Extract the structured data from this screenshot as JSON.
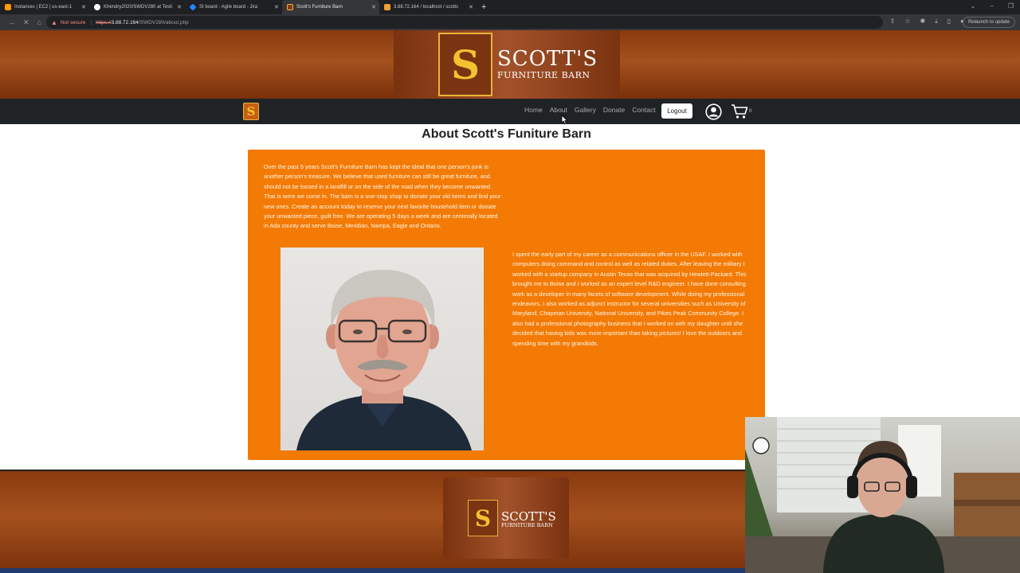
{
  "browser": {
    "tabs": [
      {
        "title": "Instances | EC2 | us-east-1",
        "color": "#ff9900",
        "active": false
      },
      {
        "title": "Khendry2020/SWDV280 at Testi",
        "color": "#ffffff",
        "active": false
      },
      {
        "title": "SI board - Agile board - Jira",
        "color": "#2684ff",
        "active": false
      },
      {
        "title": "Scott's Furniture Barn",
        "color": "#e6b53a",
        "active": true
      },
      {
        "title": "3.88.72.164 / localhost / scotts",
        "color": "#f0a030",
        "active": false
      }
    ],
    "address": {
      "security_label": "Not secure",
      "scheme": "https://",
      "host": "3.88.72.164",
      "path": "/SWDV280/about.php"
    },
    "relaunch_label": "Relaunch to update"
  },
  "site": {
    "logo": {
      "letter": "S",
      "name": "SCOTT'S",
      "subtitle": "FURNITURE BARN"
    },
    "nav": {
      "brand_letter": "S",
      "links": [
        "Home",
        "About",
        "Gallery",
        "Donate",
        "Contact"
      ],
      "logout_label": "Logout",
      "cart_count": "0"
    },
    "page_title": "About Scott's Funiture Barn",
    "intro_text": "Over the past 5 years Scott's Furniture Barn has kept the ideal that one person's junk is another person's treasure. We believe that used furniture can still be great furniture, and should not be tossed in a landfill or on the side of the road when they become unwanted. That is were we come in. The barn is a one-stop shop to donate your old items and find your new ones. Create an account today to reserve your next favorite household item or donate your unwanted piece, guilt free. We are operating 5 days a week and are centerally located in Ada county and serve Boise, Meridian, Nampa, Eagle and Ontario.",
    "bio_text": "I spent the early part of my career as a communications officer in the USAF. I worked with computers doing command and control as well as related duties. After leaving the military I worked with a startup company in Austin Texas that was acquired by Hewlett-Packard. This brought me to Boise and I worked as an expert level R&D engineer. I have done consulting work as a developer in many facets of software development. While doing my professional endeavors, I also worked as adjunct instructor for several universities such as University of Maryland, Chapman University, National University, and Pikes Peak Community College. I also had a professional photography business that I worked on with my daughter until she decided that having kids was more important than taking pictures! I love the outdoors and spending time with my grandkids.",
    "footer_logo": {
      "letter": "S",
      "name": "SCOTT'S",
      "subtitle": "FURNITURE BARN"
    }
  },
  "colors": {
    "accent": "#f37a05",
    "header_brown": "#8a3a0e",
    "nav_dark": "#1f2326",
    "gold": "#e6b53a"
  }
}
